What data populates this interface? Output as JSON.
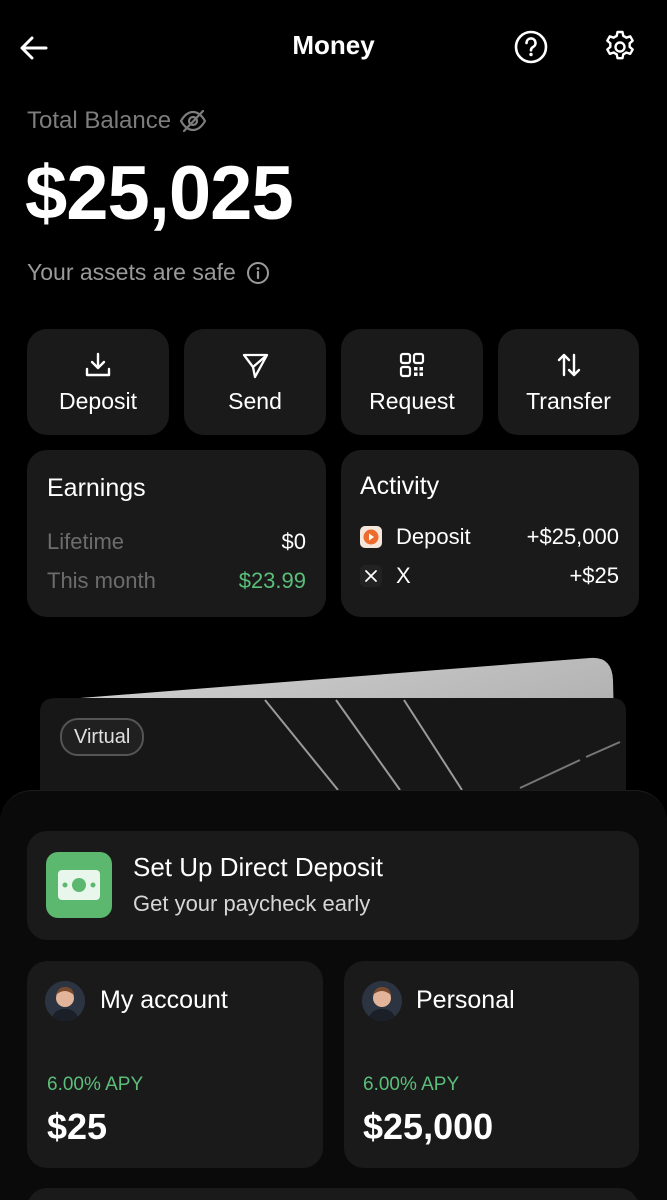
{
  "header": {
    "title": "Money",
    "back_icon": "arrow-left-icon",
    "help_icon": "question-circle-icon",
    "settings_icon": "gear-icon"
  },
  "balance": {
    "label": "Total Balance",
    "amount": "$25,025",
    "safe_text": "Your assets are safe"
  },
  "actions": [
    {
      "label": "Deposit",
      "icon": "download-icon"
    },
    {
      "label": "Send",
      "icon": "send-icon"
    },
    {
      "label": "Request",
      "icon": "qr-code-icon"
    },
    {
      "label": "Transfer",
      "icon": "transfer-arrows-icon"
    }
  ],
  "earnings": {
    "title": "Earnings",
    "rows": [
      {
        "label": "Lifetime",
        "value": "$0"
      },
      {
        "label": "This month",
        "value": "$23.99"
      }
    ]
  },
  "activity": {
    "title": "Activity",
    "rows": [
      {
        "label": "Deposit",
        "value": "+$25,000",
        "icon": "deposit-app-icon"
      },
      {
        "label": "X",
        "value": "+$25",
        "icon": "x-logo-icon"
      }
    ]
  },
  "card": {
    "badge": "Virtual"
  },
  "direct_deposit": {
    "title": "Set Up Direct Deposit",
    "subtitle": "Get your paycheck early",
    "icon": "cash-icon"
  },
  "accounts": [
    {
      "name": "My account",
      "apy": "6.00% APY",
      "amount": "$25"
    },
    {
      "name": "Personal",
      "apy": "6.00% APY",
      "amount": "$25,000"
    }
  ],
  "colors": {
    "background": "#000000",
    "tile": "#1a1a1a",
    "positive": "#5bbf7a",
    "cash_icon_bg": "#5cb86e"
  }
}
